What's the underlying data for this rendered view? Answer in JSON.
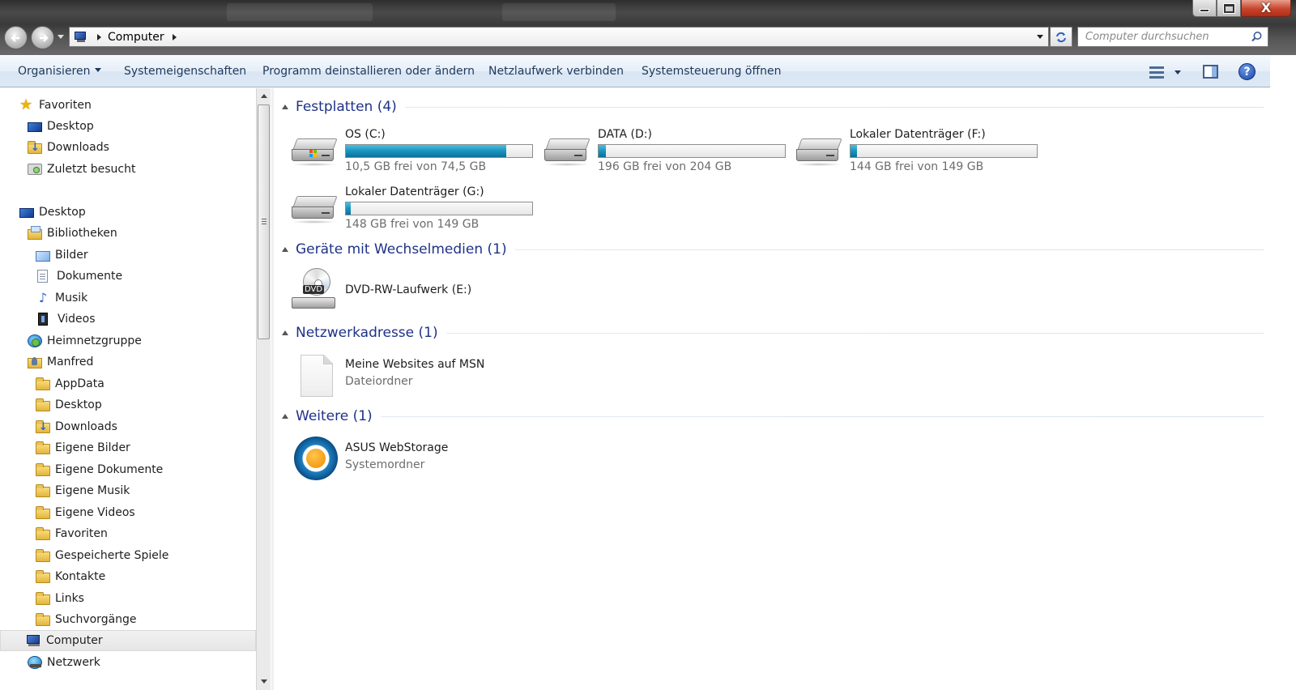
{
  "window": {
    "close_glyph": "X"
  },
  "address": {
    "breadcrumb": [
      "Computer"
    ]
  },
  "search": {
    "placeholder": "Computer durchsuchen"
  },
  "toolbar": {
    "organize": "Organisieren",
    "system_properties": "Systemeigenschaften",
    "uninstall": "Programm deinstallieren oder ändern",
    "map_drive": "Netzlaufwerk verbinden",
    "control_panel": "Systemsteuerung öffnen",
    "help_glyph": "?"
  },
  "sidebar": {
    "items": [
      {
        "label": "Favoriten",
        "icon": "star-icon"
      },
      {
        "label": "Desktop",
        "icon": "desktop-icon"
      },
      {
        "label": "Downloads",
        "icon": "downloads-folder-icon"
      },
      {
        "label": "Zuletzt besucht",
        "icon": "recent-places-icon"
      },
      {
        "label": "Desktop",
        "icon": "desktop-icon"
      },
      {
        "label": "Bibliotheken",
        "icon": "libraries-icon"
      },
      {
        "label": "Bilder",
        "icon": "pictures-icon"
      },
      {
        "label": "Dokumente",
        "icon": "documents-icon"
      },
      {
        "label": "Musik",
        "icon": "music-icon"
      },
      {
        "label": "Videos",
        "icon": "videos-icon"
      },
      {
        "label": "Heimnetzgruppe",
        "icon": "homegroup-icon"
      },
      {
        "label": "Manfred",
        "icon": "user-folder-icon"
      },
      {
        "label": "AppData",
        "icon": "folder-icon"
      },
      {
        "label": "Desktop",
        "icon": "desktop-folder-icon"
      },
      {
        "label": "Downloads",
        "icon": "downloads-folder-icon"
      },
      {
        "label": "Eigene Bilder",
        "icon": "pictures-folder-icon"
      },
      {
        "label": "Eigene Dokumente",
        "icon": "documents-folder-icon"
      },
      {
        "label": "Eigene Musik",
        "icon": "music-folder-icon"
      },
      {
        "label": "Eigene Videos",
        "icon": "videos-folder-icon"
      },
      {
        "label": "Favoriten",
        "icon": "favorites-folder-icon"
      },
      {
        "label": "Gespeicherte Spiele",
        "icon": "saved-games-folder-icon"
      },
      {
        "label": "Kontakte",
        "icon": "contacts-folder-icon"
      },
      {
        "label": "Links",
        "icon": "links-folder-icon"
      },
      {
        "label": "Suchvorgänge",
        "icon": "searches-folder-icon"
      },
      {
        "label": "Computer",
        "icon": "computer-icon",
        "selected": true
      },
      {
        "label": "Netzwerk",
        "icon": "network-icon"
      }
    ]
  },
  "groups": {
    "hard_drives": {
      "title": "Festplatten (4)",
      "drives": [
        {
          "name": "OS (C:)",
          "free": "10,5 GB frei von 74,5 GB",
          "used_fraction": 0.86,
          "system": true
        },
        {
          "name": "DATA (D:)",
          "free": "196 GB frei von 204 GB",
          "used_fraction": 0.04
        },
        {
          "name": "Lokaler Datenträger (F:)",
          "free": "144 GB frei von 149 GB",
          "used_fraction": 0.034
        },
        {
          "name": "Lokaler Datenträger (G:)",
          "free": "148 GB frei von 149 GB",
          "used_fraction": 0.007
        }
      ]
    },
    "removable": {
      "title": "Geräte mit Wechselmedien (1)",
      "items": [
        {
          "name": "DVD-RW-Laufwerk (E:)",
          "badge": "DVD"
        }
      ]
    },
    "network": {
      "title": "Netzwerkadresse (1)",
      "items": [
        {
          "name": "Meine Websites auf MSN",
          "type": "Dateiordner"
        }
      ]
    },
    "other": {
      "title": "Weitere (1)",
      "items": [
        {
          "name": "ASUS WebStorage",
          "type": "Systemordner"
        }
      ]
    }
  },
  "colors": {
    "accent_header": "#1e3287",
    "bar_fill": "#1d97c2",
    "command_bar": "#dde8f5"
  }
}
